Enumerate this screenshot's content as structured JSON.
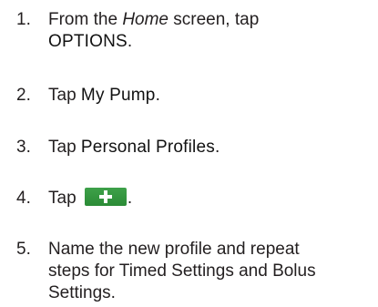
{
  "steps": [
    {
      "number": "1.",
      "pre": "From the ",
      "italic": "Home",
      "mid": " screen, tap",
      "button": "OPTIONS",
      "post": "."
    },
    {
      "number": "2.",
      "pre": "Tap ",
      "button": "My Pump",
      "post": "."
    },
    {
      "number": "3.",
      "pre": "Tap ",
      "button": "Personal Profiles",
      "post": "."
    },
    {
      "number": "4.",
      "pre": "Tap ",
      "icon": "plus-icon",
      "icon_color": "#34993f",
      "post": "."
    },
    {
      "number": "5.",
      "line1": "Name the new profile and repeat",
      "line2": "steps for Timed Settings and Bolus",
      "line3": "Settings."
    }
  ]
}
